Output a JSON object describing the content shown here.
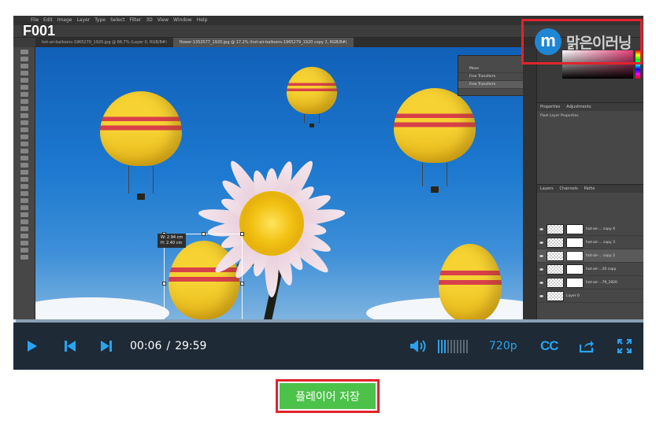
{
  "video": {
    "id": "F001",
    "watermark_logo": "m",
    "watermark_brand": "맑은이러닝"
  },
  "photoshop": {
    "menu": [
      "File",
      "Edit",
      "Image",
      "Layer",
      "Type",
      "Select",
      "Filter",
      "3D",
      "View",
      "Window",
      "Help"
    ],
    "tabs": [
      "hot-air-balloons-1965279_1920.jpg @ 66.7% (Layer 0, RGB/8#)",
      "flower-1352577_1920.jpg @ 17.2% (hot-air-balloons-1965279_1920 copy 2, RGB/8#)"
    ],
    "history": [
      "Move",
      "Free Transform",
      "Free Transform"
    ],
    "properties_tabs": [
      "Properties",
      "Adjustments"
    ],
    "properties_label": "Pixel Layer Properties",
    "layers_tabs": [
      "Layers",
      "Channels",
      "Paths"
    ],
    "layers": [
      {
        "name": "hot-air-... copy 4"
      },
      {
        "name": "hot-air-... copy 3"
      },
      {
        "name": "hot-air-... copy 2"
      },
      {
        "name": "hot-air-...20 copy"
      },
      {
        "name": "hot-air-...79_1920"
      },
      {
        "name": "Layer 0"
      }
    ],
    "readout_w": "W: 2.94 cm",
    "readout_h": "H: 2.40 cm"
  },
  "player": {
    "current_time": "00:06",
    "time_sep": "/",
    "duration": "29:59",
    "quality": "720p",
    "cc_label": "CC",
    "progress_fraction": 0.0034,
    "volume_level": 3,
    "volume_max": 10
  },
  "save_button_label": "플레이어 저장",
  "colors": {
    "accent": "#2aa3ef",
    "controls_bg": "#1e2a36",
    "save_green": "#4dc24a",
    "highlight_red": "#e0242c"
  },
  "icons": [
    "play-icon",
    "skip-back-icon",
    "skip-forward-icon",
    "volume-icon",
    "share-icon",
    "fullscreen-icon"
  ]
}
